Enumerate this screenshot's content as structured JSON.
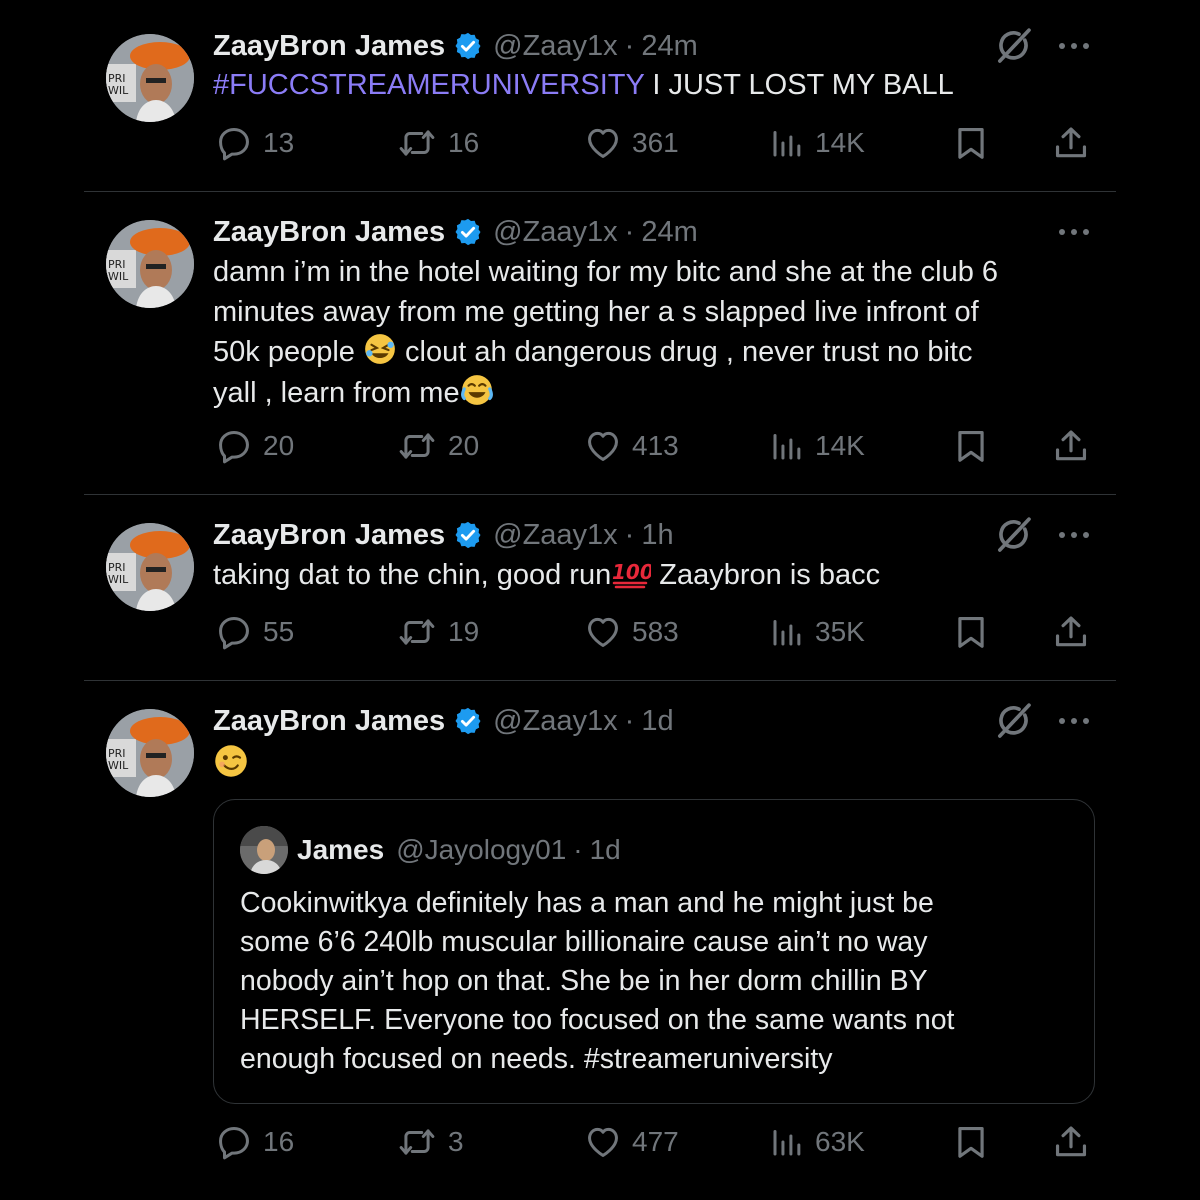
{
  "account": {
    "name": "ZaayBron James",
    "handle": "@Zaay1x",
    "separator": "·"
  },
  "tweets": [
    {
      "time": "24m",
      "hashtag": "#FUCCSTREAMERUNIVERSITY",
      "text": " I JUST LOST MY BALL",
      "replies": "13",
      "reposts": "16",
      "likes": "361",
      "views": "14K",
      "show_grok": true
    },
    {
      "time": "24m",
      "lines": [
        "damn i’m in the hotel waiting for my bitc   and she at the club 6",
        "minutes away from me getting her a  s slapped live infront of",
        "50k people ",
        " clout ah dangerous drug , never trust no bitc",
        "yall , learn from me"
      ],
      "replies": "20",
      "reposts": "20",
      "likes": "413",
      "views": "14K",
      "show_grok": false
    },
    {
      "time": "1h",
      "text": "taking dat to the chin, good run",
      "text_after": "  Zaaybron is bacc",
      "replies": "55",
      "reposts": "19",
      "likes": "583",
      "views": "35K",
      "show_grok": true
    },
    {
      "time": "1d",
      "replies": "16",
      "reposts": "3",
      "likes": "477",
      "views": "63K",
      "show_grok": true,
      "quote": {
        "name": "James",
        "handle": "@Jayology01",
        "time": "1d",
        "lines": [
          "Cookinwitkya definitely has a man and he might just be",
          "some 6’6 240lb muscular billionaire cause ain’t no way",
          "nobody ain’t hop on that. She be in her dorm chillin BY",
          "HERSELF. Everyone too focused on the same wants not",
          "enough focused on needs. #streameruniversity"
        ]
      }
    }
  ],
  "icons": {
    "reply": "reply-icon",
    "repost": "repost-icon",
    "like": "like-icon",
    "views": "views-icon",
    "bookmark": "bookmark-icon",
    "share": "share-icon",
    "grok": "grok-icon",
    "more": "more-icon",
    "verified": "verified-badge-icon"
  },
  "colors": {
    "background": "#000000",
    "text": "#e7e9ea",
    "secondary": "#71767b",
    "hashtag": "#8b7cf6",
    "verified": "#1d9bf0",
    "divider": "#2f3336"
  }
}
